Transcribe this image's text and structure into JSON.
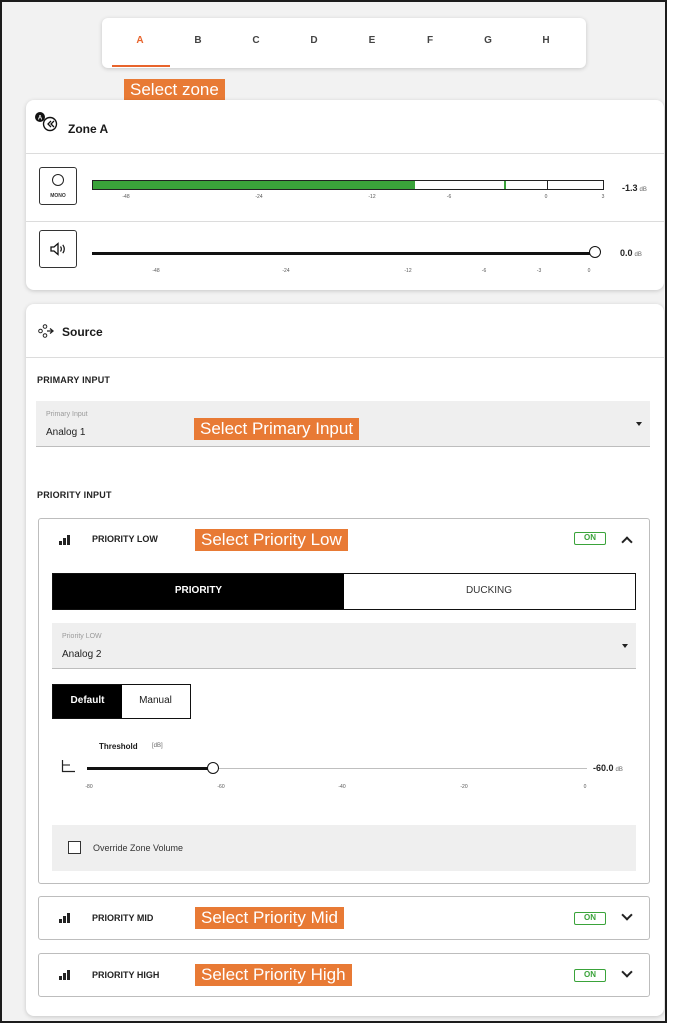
{
  "tabs": {
    "items": [
      "A",
      "B",
      "C",
      "D",
      "E",
      "F",
      "G",
      "H"
    ],
    "active_index": 0,
    "annotation": "Select zone"
  },
  "zone": {
    "title": "Zone A",
    "mono_label": "MONO",
    "meter": {
      "ticks": [
        "-48",
        "-24",
        "-12",
        "-6",
        "0",
        "3"
      ],
      "level_db": -1.3,
      "value_text": "-1.3",
      "unit": "dB"
    },
    "volume": {
      "ticks": [
        "-48",
        "-24",
        "-12",
        "-6",
        "-3",
        "0"
      ],
      "value_db": 0.0,
      "value_text": "0.0",
      "unit": "dB"
    }
  },
  "source": {
    "title": "Source",
    "primary": {
      "section_label": "PRIMARY INPUT",
      "field_label": "Primary Input",
      "value": "Analog 1",
      "annotation": "Select Primary Input"
    },
    "priority_section_label": "PRIORITY INPUT",
    "priority_low": {
      "title": "PRIORITY LOW",
      "annotation": "Select Priority Low",
      "status": "ON",
      "tabs": [
        "PRIORITY",
        "DUCKING"
      ],
      "field_label": "Priority LOW",
      "value": "Analog 2",
      "modes": [
        "Default",
        "Manual"
      ],
      "threshold_label": "Threshold",
      "threshold_unit": "[dB]",
      "threshold_ticks": [
        "-80",
        "-60",
        "-40",
        "-20",
        "0"
      ],
      "threshold_value_db": -60.0,
      "threshold_value_text": "-60.0",
      "threshold_value_unit": "dB",
      "override_label": "Override Zone Volume",
      "override_checked": false
    },
    "priority_mid": {
      "title": "PRIORITY MID",
      "annotation": "Select Priority Mid",
      "status": "ON"
    },
    "priority_high": {
      "title": "PRIORITY HIGH",
      "annotation": "Select Priority High",
      "status": "ON"
    }
  },
  "colors": {
    "accent_orange": "#e8642c",
    "annotation_orange": "#e87a35",
    "meter_green": "#3aa33a"
  }
}
